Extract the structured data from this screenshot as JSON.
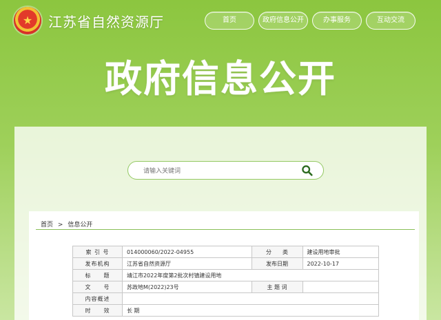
{
  "header": {
    "site_name": "江苏省自然资源厅",
    "nav": [
      "首页",
      "政府信息公开",
      "办事服务",
      "互动交流"
    ]
  },
  "hero": {
    "title": "政府信息公开"
  },
  "search": {
    "placeholder": "请输入关键词"
  },
  "breadcrumb": [
    "首页",
    "信息公开"
  ],
  "table": {
    "rows": [
      {
        "label1": "索 引 号",
        "value1": "014000060/2022-04955",
        "label2": "分　　类",
        "value2": "建设用地审批"
      },
      {
        "label1": "发布机构",
        "value1": "江苏省自然资源厅",
        "label2": "发布日期",
        "value2": "2022-10-17"
      },
      {
        "label1": "标　　题",
        "value1": "靖江市2022年度第2批次村镇建设用地"
      },
      {
        "label1": "文　　号",
        "value1": "苏政地M(2022)23号",
        "label2": "主 题 词",
        "value2": ""
      },
      {
        "label1": "内容概述",
        "value1": ""
      },
      {
        "label1": "时　　效",
        "value1": "长 期"
      }
    ]
  },
  "colors": {
    "green": "#8cc63f",
    "green_dark": "#88be56"
  }
}
